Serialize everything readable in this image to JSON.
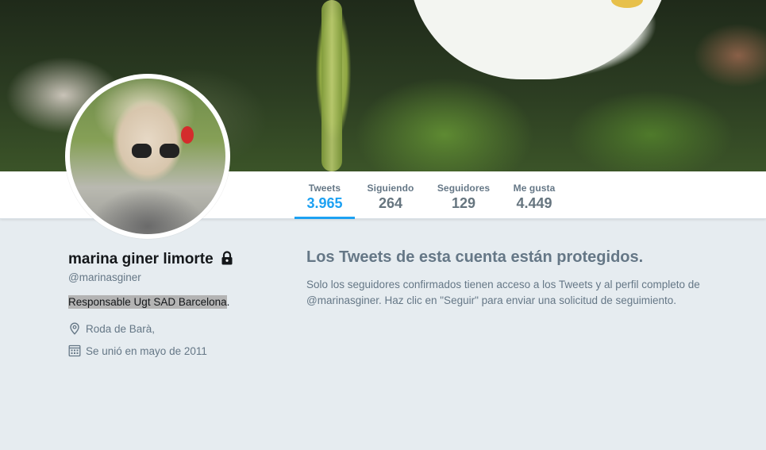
{
  "profile": {
    "name": "marina giner limorte",
    "handle": "@marinasginer",
    "bio_highlighted": "Responsable Ugt SAD Barcelona",
    "bio_tail": ".",
    "location": "Roda de Barà,",
    "joined": "Se unió en mayo de 2011"
  },
  "stats": [
    {
      "label": "Tweets",
      "value": "3.965",
      "active": true
    },
    {
      "label": "Siguiendo",
      "value": "264",
      "active": false
    },
    {
      "label": "Seguidores",
      "value": "129",
      "active": false
    },
    {
      "label": "Me gusta",
      "value": "4.449",
      "active": false
    }
  ],
  "protected": {
    "title": "Los Tweets de esta cuenta están protegidos.",
    "message": "Solo los seguidores confirmados tienen acceso a los Tweets y al perfil completo de @marinasginer. Haz clic en \"Seguir\" para enviar una solicitud de seguimiento."
  },
  "icons": {
    "lock": "lock-icon",
    "location": "location-pin-icon",
    "calendar": "calendar-icon"
  },
  "colors": {
    "accent": "#1da1f2",
    "background": "#e6ecf0",
    "secondary_text": "#657786"
  }
}
